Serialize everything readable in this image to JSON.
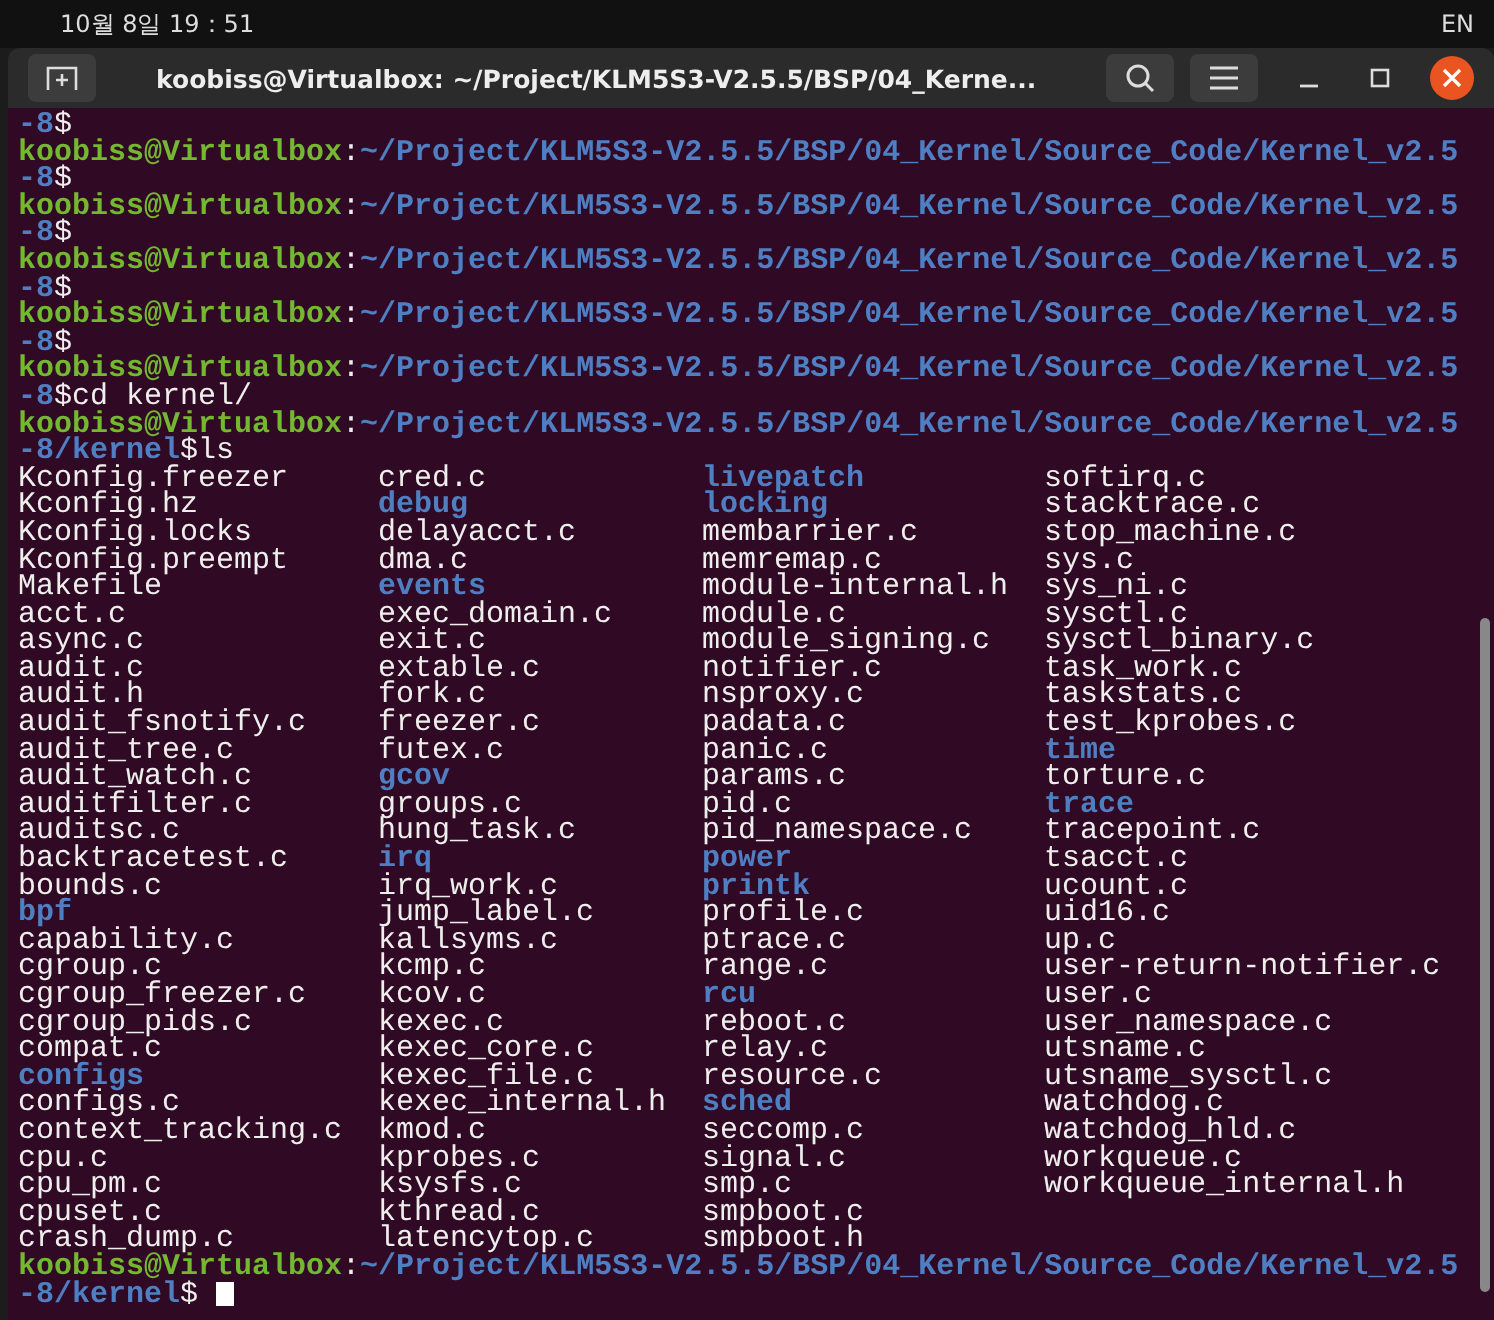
{
  "top_bar": {
    "clock": "10월 8일 19：51",
    "input_method": "EN"
  },
  "window": {
    "title": "koobiss@Virtualbox: ~/Project/KLM5S3-V2.5.5/BSP/04_Kerne..."
  },
  "terminal": {
    "lines": [
      {
        "kind": "continuation",
        "path": "-8",
        "sign": "$"
      },
      {
        "kind": "prompt",
        "user": "koobiss@Virtualbox",
        "colon": ":",
        "path": "~/Project/KLM5S3-V2.5.5/BSP/04_Kernel/Source_Code/Kernel_v2.5",
        "path_cont": "-8",
        "sign": "$"
      },
      {
        "kind": "prompt",
        "user": "koobiss@Virtualbox",
        "colon": ":",
        "path": "~/Project/KLM5S3-V2.5.5/BSP/04_Kernel/Source_Code/Kernel_v2.5",
        "path_cont": "-8",
        "sign": "$"
      },
      {
        "kind": "prompt",
        "user": "koobiss@Virtualbox",
        "colon": ":",
        "path": "~/Project/KLM5S3-V2.5.5/BSP/04_Kernel/Source_Code/Kernel_v2.5",
        "path_cont": "-8",
        "sign": "$"
      },
      {
        "kind": "prompt",
        "user": "koobiss@Virtualbox",
        "colon": ":",
        "path": "~/Project/KLM5S3-V2.5.5/BSP/04_Kernel/Source_Code/Kernel_v2.5",
        "path_cont": "-8",
        "sign": "$"
      },
      {
        "kind": "prompt",
        "user": "koobiss@Virtualbox",
        "colon": ":",
        "path": "~/Project/KLM5S3-V2.5.5/BSP/04_Kernel/Source_Code/Kernel_v2.5",
        "path_cont": "-8",
        "sign": "$",
        "command": "cd kernel/"
      },
      {
        "kind": "prompt",
        "user": "koobiss@Virtualbox",
        "colon": ":",
        "path": "~/Project/KLM5S3-V2.5.5/BSP/04_Kernel/Source_Code/Kernel_v2.5",
        "path_cont": "-8/kernel",
        "sign": "$",
        "command": "ls"
      }
    ],
    "ls_columns": [
      [
        {
          "name": "Kconfig.freezer",
          "kind": "file"
        },
        {
          "name": "Kconfig.hz",
          "kind": "file"
        },
        {
          "name": "Kconfig.locks",
          "kind": "file"
        },
        {
          "name": "Kconfig.preempt",
          "kind": "file"
        },
        {
          "name": "Makefile",
          "kind": "file"
        },
        {
          "name": "acct.c",
          "kind": "file"
        },
        {
          "name": "async.c",
          "kind": "file"
        },
        {
          "name": "audit.c",
          "kind": "file"
        },
        {
          "name": "audit.h",
          "kind": "file"
        },
        {
          "name": "audit_fsnotify.c",
          "kind": "file"
        },
        {
          "name": "audit_tree.c",
          "kind": "file"
        },
        {
          "name": "audit_watch.c",
          "kind": "file"
        },
        {
          "name": "auditfilter.c",
          "kind": "file"
        },
        {
          "name": "auditsc.c",
          "kind": "file"
        },
        {
          "name": "backtracetest.c",
          "kind": "file"
        },
        {
          "name": "bounds.c",
          "kind": "file"
        },
        {
          "name": "bpf",
          "kind": "dir"
        },
        {
          "name": "capability.c",
          "kind": "file"
        },
        {
          "name": "cgroup.c",
          "kind": "file"
        },
        {
          "name": "cgroup_freezer.c",
          "kind": "file"
        },
        {
          "name": "cgroup_pids.c",
          "kind": "file"
        },
        {
          "name": "compat.c",
          "kind": "file"
        },
        {
          "name": "configs",
          "kind": "dir"
        },
        {
          "name": "configs.c",
          "kind": "file"
        },
        {
          "name": "context_tracking.c",
          "kind": "file"
        },
        {
          "name": "cpu.c",
          "kind": "file"
        },
        {
          "name": "cpu_pm.c",
          "kind": "file"
        },
        {
          "name": "cpuset.c",
          "kind": "file"
        },
        {
          "name": "crash_dump.c",
          "kind": "file"
        }
      ],
      [
        {
          "name": "cred.c",
          "kind": "file"
        },
        {
          "name": "debug",
          "kind": "dir"
        },
        {
          "name": "delayacct.c",
          "kind": "file"
        },
        {
          "name": "dma.c",
          "kind": "file"
        },
        {
          "name": "events",
          "kind": "dir"
        },
        {
          "name": "exec_domain.c",
          "kind": "file"
        },
        {
          "name": "exit.c",
          "kind": "file"
        },
        {
          "name": "extable.c",
          "kind": "file"
        },
        {
          "name": "fork.c",
          "kind": "file"
        },
        {
          "name": "freezer.c",
          "kind": "file"
        },
        {
          "name": "futex.c",
          "kind": "file"
        },
        {
          "name": "gcov",
          "kind": "dir"
        },
        {
          "name": "groups.c",
          "kind": "file"
        },
        {
          "name": "hung_task.c",
          "kind": "file"
        },
        {
          "name": "irq",
          "kind": "dir"
        },
        {
          "name": "irq_work.c",
          "kind": "file"
        },
        {
          "name": "jump_label.c",
          "kind": "file"
        },
        {
          "name": "kallsyms.c",
          "kind": "file"
        },
        {
          "name": "kcmp.c",
          "kind": "file"
        },
        {
          "name": "kcov.c",
          "kind": "file"
        },
        {
          "name": "kexec.c",
          "kind": "file"
        },
        {
          "name": "kexec_core.c",
          "kind": "file"
        },
        {
          "name": "kexec_file.c",
          "kind": "file"
        },
        {
          "name": "kexec_internal.h",
          "kind": "file"
        },
        {
          "name": "kmod.c",
          "kind": "file"
        },
        {
          "name": "kprobes.c",
          "kind": "file"
        },
        {
          "name": "ksysfs.c",
          "kind": "file"
        },
        {
          "name": "kthread.c",
          "kind": "file"
        },
        {
          "name": "latencytop.c",
          "kind": "file"
        }
      ],
      [
        {
          "name": "livepatch",
          "kind": "dir"
        },
        {
          "name": "locking",
          "kind": "dir"
        },
        {
          "name": "membarrier.c",
          "kind": "file"
        },
        {
          "name": "memremap.c",
          "kind": "file"
        },
        {
          "name": "module-internal.h",
          "kind": "file"
        },
        {
          "name": "module.c",
          "kind": "file"
        },
        {
          "name": "module_signing.c",
          "kind": "file"
        },
        {
          "name": "notifier.c",
          "kind": "file"
        },
        {
          "name": "nsproxy.c",
          "kind": "file"
        },
        {
          "name": "padata.c",
          "kind": "file"
        },
        {
          "name": "panic.c",
          "kind": "file"
        },
        {
          "name": "params.c",
          "kind": "file"
        },
        {
          "name": "pid.c",
          "kind": "file"
        },
        {
          "name": "pid_namespace.c",
          "kind": "file"
        },
        {
          "name": "power",
          "kind": "dir"
        },
        {
          "name": "printk",
          "kind": "dir"
        },
        {
          "name": "profile.c",
          "kind": "file"
        },
        {
          "name": "ptrace.c",
          "kind": "file"
        },
        {
          "name": "range.c",
          "kind": "file"
        },
        {
          "name": "rcu",
          "kind": "dir"
        },
        {
          "name": "reboot.c",
          "kind": "file"
        },
        {
          "name": "relay.c",
          "kind": "file"
        },
        {
          "name": "resource.c",
          "kind": "file"
        },
        {
          "name": "sched",
          "kind": "dir"
        },
        {
          "name": "seccomp.c",
          "kind": "file"
        },
        {
          "name": "signal.c",
          "kind": "file"
        },
        {
          "name": "smp.c",
          "kind": "file"
        },
        {
          "name": "smpboot.c",
          "kind": "file"
        },
        {
          "name": "smpboot.h",
          "kind": "file"
        }
      ],
      [
        {
          "name": "softirq.c",
          "kind": "file"
        },
        {
          "name": "stacktrace.c",
          "kind": "file"
        },
        {
          "name": "stop_machine.c",
          "kind": "file"
        },
        {
          "name": "sys.c",
          "kind": "file"
        },
        {
          "name": "sys_ni.c",
          "kind": "file"
        },
        {
          "name": "sysctl.c",
          "kind": "file"
        },
        {
          "name": "sysctl_binary.c",
          "kind": "file"
        },
        {
          "name": "task_work.c",
          "kind": "file"
        },
        {
          "name": "taskstats.c",
          "kind": "file"
        },
        {
          "name": "test_kprobes.c",
          "kind": "file"
        },
        {
          "name": "time",
          "kind": "dir"
        },
        {
          "name": "torture.c",
          "kind": "file"
        },
        {
          "name": "trace",
          "kind": "dir"
        },
        {
          "name": "tracepoint.c",
          "kind": "file"
        },
        {
          "name": "tsacct.c",
          "kind": "file"
        },
        {
          "name": "ucount.c",
          "kind": "file"
        },
        {
          "name": "uid16.c",
          "kind": "file"
        },
        {
          "name": "up.c",
          "kind": "file"
        },
        {
          "name": "user-return-notifier.c",
          "kind": "file"
        },
        {
          "name": "user.c",
          "kind": "file"
        },
        {
          "name": "user_namespace.c",
          "kind": "file"
        },
        {
          "name": "utsname.c",
          "kind": "file"
        },
        {
          "name": "utsname_sysctl.c",
          "kind": "file"
        },
        {
          "name": "watchdog.c",
          "kind": "file"
        },
        {
          "name": "watchdog_hld.c",
          "kind": "file"
        },
        {
          "name": "workqueue.c",
          "kind": "file"
        },
        {
          "name": "workqueue_internal.h",
          "kind": "file"
        }
      ]
    ],
    "final_prompt": {
      "user": "koobiss@Virtualbox",
      "colon": ":",
      "path": "~/Project/KLM5S3-V2.5.5/BSP/04_Kernel/Source_Code/Kernel_v2.5",
      "path_cont": "-8/kernel",
      "sign": "$"
    }
  }
}
